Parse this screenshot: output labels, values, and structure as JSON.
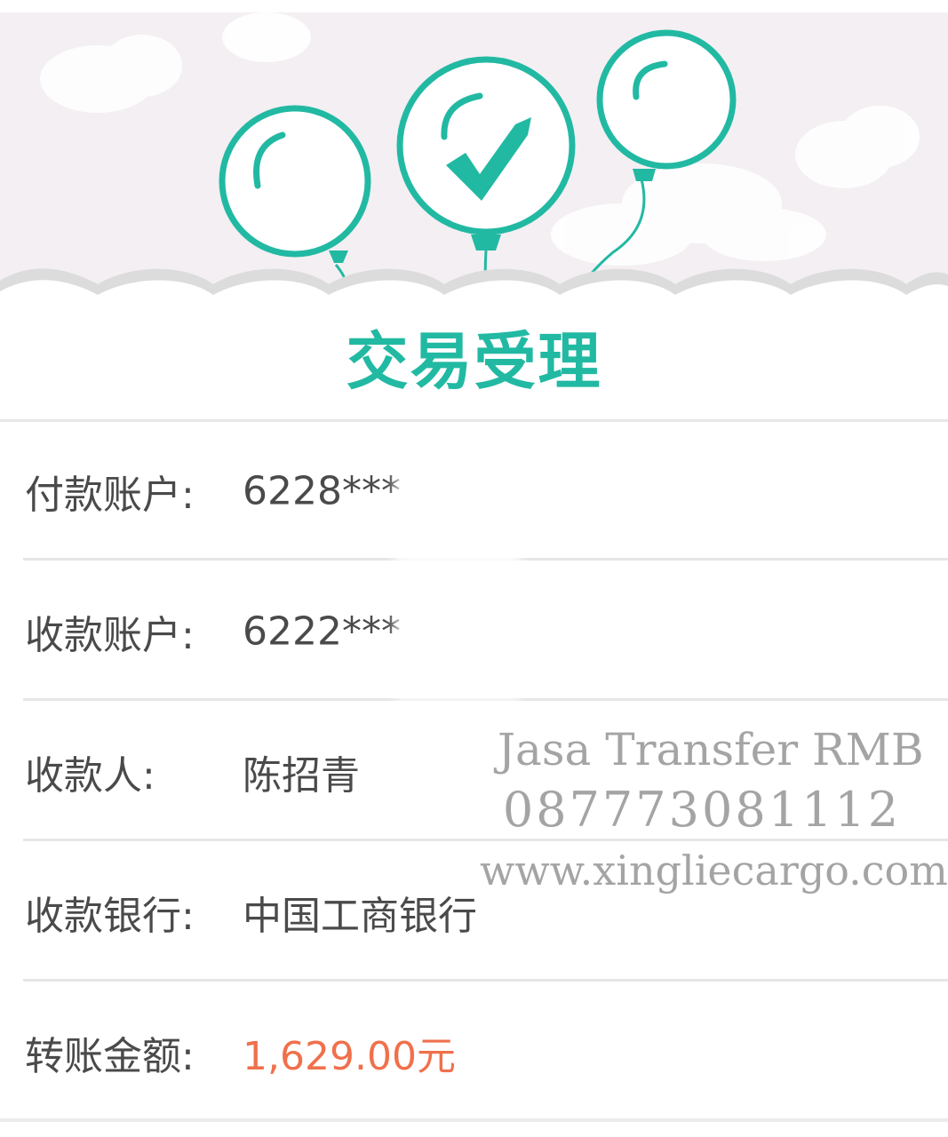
{
  "header": {
    "title": "交易受理",
    "accent_color": "#22b9a3",
    "illustration": {
      "icons": [
        "balloon-icon",
        "checkmark-balloon-icon",
        "balloon-icon",
        "cloud-icon"
      ]
    }
  },
  "details": {
    "rows": [
      {
        "label": "付款账户:",
        "value": "6228***"
      },
      {
        "label": "收款账户:",
        "value": "6222***"
      },
      {
        "label": "收款人:",
        "value": "陈招青"
      },
      {
        "label": "收款银行:",
        "value": "中国工商银行"
      },
      {
        "label": "转账金额:",
        "value": "1,629.00元"
      }
    ],
    "amount_color": "#f0704c"
  },
  "watermark": {
    "line1": "Jasa Transfer RMB",
    "line2": "087773081112",
    "line3": "www.xingliecargo.com"
  }
}
